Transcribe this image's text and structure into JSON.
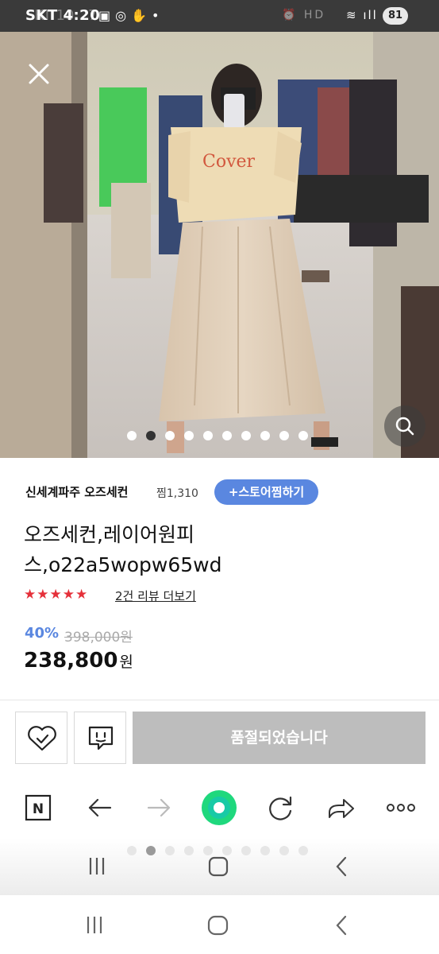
{
  "status_bar": {
    "carrier_time": "SKT 4:20",
    "ghost_time": "SKT 10:27",
    "battery": "81"
  },
  "colors": {
    "accent": "#5a87e0",
    "stars": "#e5303a",
    "soldout_bg": "#bdbdbd",
    "green_button": "#1fd87d"
  },
  "gallery": {
    "image_count": 10,
    "active_index": 1
  },
  "store": {
    "name": "신세계파주 오즈세컨",
    "wish_label": "찜1,310",
    "follow_button": "+스토어찜하기"
  },
  "product": {
    "title_line1": "오즈세컨,레이어원피",
    "title_line2": "스,o22a5wopw65wd",
    "stars": "★★★★★",
    "review_link": "2건 리뷰 더보기",
    "discount": "40%",
    "original_price": "398,000원",
    "price": "238,800",
    "price_unit": "원"
  },
  "actions": {
    "soldout_label": "품절되었습니다",
    "wish_icon": "heart-check-icon",
    "talk_icon": "chat-icon"
  },
  "toolbar": {
    "home_label": "N"
  }
}
